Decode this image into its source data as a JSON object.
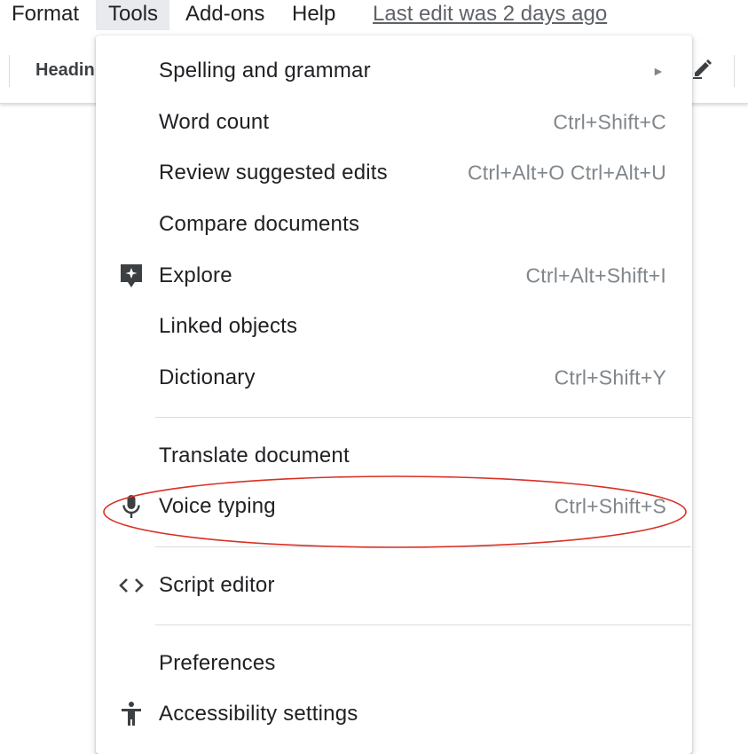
{
  "menubar": {
    "items": [
      "Format",
      "Tools",
      "Add-ons",
      "Help"
    ],
    "last_edit": "Last edit was 2 days ago"
  },
  "toolbar": {
    "style_label": "Headin"
  },
  "tools_menu": {
    "spelling": {
      "label": "Spelling and grammar",
      "arrow": "►"
    },
    "word_count": {
      "label": "Word count",
      "shortcut": "Ctrl+Shift+C"
    },
    "review_edits": {
      "label": "Review suggested edits",
      "shortcut": "Ctrl+Alt+O Ctrl+Alt+U"
    },
    "compare": {
      "label": "Compare documents"
    },
    "explore": {
      "label": "Explore",
      "shortcut": "Ctrl+Alt+Shift+I",
      "icon": "explore-icon"
    },
    "linked": {
      "label": "Linked objects"
    },
    "dictionary": {
      "label": "Dictionary",
      "shortcut": "Ctrl+Shift+Y"
    },
    "translate": {
      "label": "Translate document"
    },
    "voice": {
      "label": "Voice typing",
      "shortcut": "Ctrl+Shift+S",
      "icon": "microphone-icon"
    },
    "script": {
      "label": "Script editor",
      "icon": "code-icon"
    },
    "preferences": {
      "label": "Preferences"
    },
    "accessibility": {
      "label": "Accessibility settings",
      "icon": "accessibility-icon"
    }
  },
  "colors": {
    "highlight_ellipse": "#d93025",
    "active_menu_bg": "#e8eaed",
    "shortcut_text": "#80868b"
  }
}
